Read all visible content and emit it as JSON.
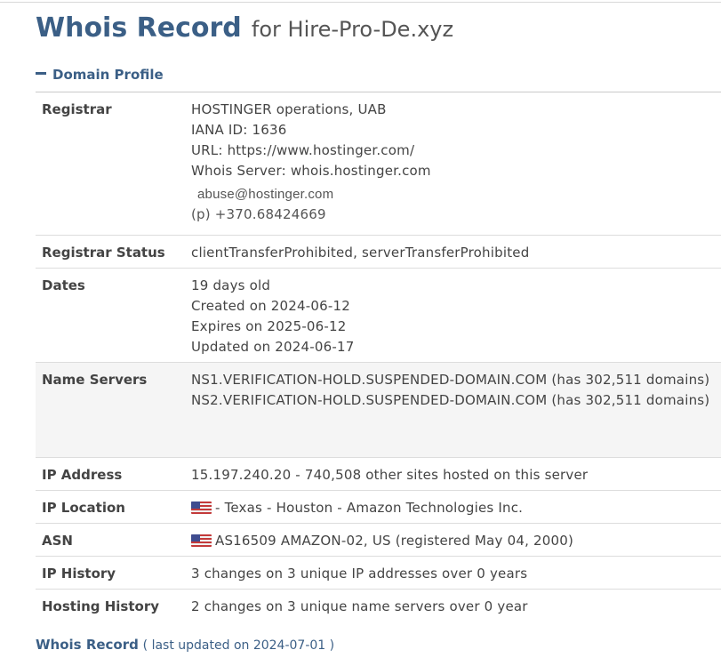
{
  "header": {
    "title_main": "Whois Record",
    "title_sub": "for Hire-Pro-De.xyz"
  },
  "section": {
    "label": "Domain Profile",
    "toggle_icon": "minus-icon"
  },
  "rows": {
    "registrar": {
      "label": "Registrar",
      "lines": [
        "HOSTINGER operations, UAB",
        "IANA ID: 1636",
        "URL: https://www.hostinger.com/",
        "Whois Server: whois.hostinger.com"
      ],
      "email": "abuse@hostinger.com",
      "phone": "(p)  +370.68424669"
    },
    "registrar_status": {
      "label": "Registrar Status",
      "value": "clientTransferProhibited, serverTransferProhibited"
    },
    "dates": {
      "label": "Dates",
      "lines": [
        "19 days old",
        "Created on 2024-06-12",
        "Expires on 2025-06-12",
        "Updated on 2024-06-17"
      ]
    },
    "name_servers": {
      "label": "Name Servers",
      "lines": [
        "NS1.VERIFICATION-HOLD.SUSPENDED-DOMAIN.COM (has 302,511 domains)",
        "NS2.VERIFICATION-HOLD.SUSPENDED-DOMAIN.COM (has 302,511 domains)"
      ]
    },
    "ip_address": {
      "label": "IP Address",
      "value": "15.197.240.20 - 740,508 other sites hosted on this server"
    },
    "ip_location": {
      "label": "IP Location",
      "value": "- Texas - Houston - Amazon Technologies Inc.",
      "flag_icon": "us-flag-icon"
    },
    "asn": {
      "label": "ASN",
      "value": "AS16509 AMAZON-02, US (registered May 04, 2000)",
      "flag_icon": "us-flag-icon"
    },
    "ip_history": {
      "label": "IP History",
      "value": "3 changes on 3 unique IP addresses over 0 years"
    },
    "hosting_history": {
      "label": "Hosting History",
      "value": "2 changes on 3 unique name servers over 0 year"
    }
  },
  "footer": {
    "link": "Whois Record",
    "note": "( last updated on 2024-07-01 )"
  },
  "colors": {
    "brand_blue": "#3b5f86",
    "row_shade": "#f5f5f5",
    "border": "#dddddd"
  }
}
